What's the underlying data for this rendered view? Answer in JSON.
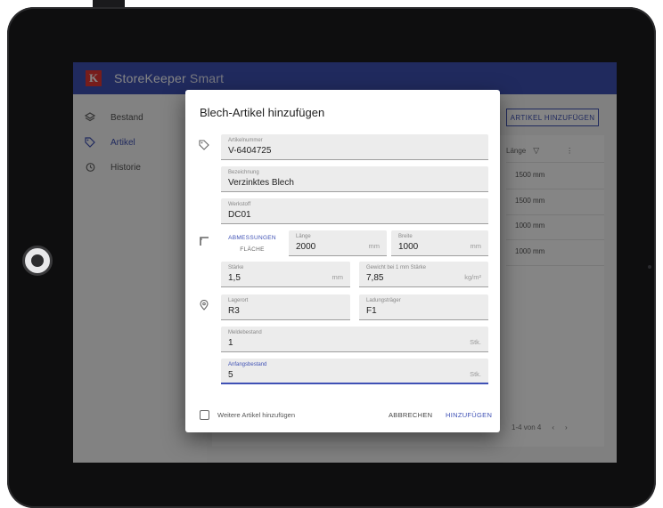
{
  "app": {
    "brand": "StoreKeeper",
    "brand_suffix": "Smart",
    "logo_letter": "K",
    "accent_color": "#3f51b5"
  },
  "sidebar": {
    "items": [
      {
        "label": "Bestand",
        "icon": "layers-icon"
      },
      {
        "label": "Artikel",
        "icon": "tags-icon"
      },
      {
        "label": "Historie",
        "icon": "history-icon"
      }
    ]
  },
  "toolbar": {
    "add_article_label": "ARTIKEL HINZUFÜGEN"
  },
  "table": {
    "column_header": "Länge",
    "rows": [
      "1500 mm",
      "1500 mm",
      "1000 mm",
      "1000 mm"
    ],
    "pagination": "1-4 von 4"
  },
  "dialog": {
    "title": "Blech-Artikel hinzufügen",
    "article_number": {
      "label": "Artikelnummer",
      "value": "V-6404725"
    },
    "description": {
      "label": "Bezeichnung",
      "value": "Verzinktes Blech"
    },
    "material": {
      "label": "Werkstoff",
      "value": "DC01"
    },
    "mode_toggle": {
      "option_dimensions": "ABMESSUNGEN",
      "option_area": "FLÄCHE"
    },
    "length": {
      "label": "Länge",
      "value": "2000",
      "unit": "mm"
    },
    "width": {
      "label": "Breite",
      "value": "1000",
      "unit": "mm"
    },
    "thickness": {
      "label": "Stärke",
      "value": "1,5",
      "unit": "mm"
    },
    "weight": {
      "label": "Gewicht bei 1 mm Stärke",
      "value": "7,85",
      "unit": "kg/m²"
    },
    "storage_location": {
      "label": "Lagerort",
      "value": "R3"
    },
    "load_carrier": {
      "label": "Ladungsträger",
      "value": "F1"
    },
    "min_stock": {
      "label": "Meldebestand",
      "value": "1",
      "unit": "Stk."
    },
    "initial_stock": {
      "label": "Anfangsbestand",
      "value": "5",
      "unit": "Stk."
    },
    "more_articles_label": "Weitere Artikel hinzufügen",
    "cancel_label": "ABBRECHEN",
    "submit_label": "HINZUFÜGEN"
  }
}
